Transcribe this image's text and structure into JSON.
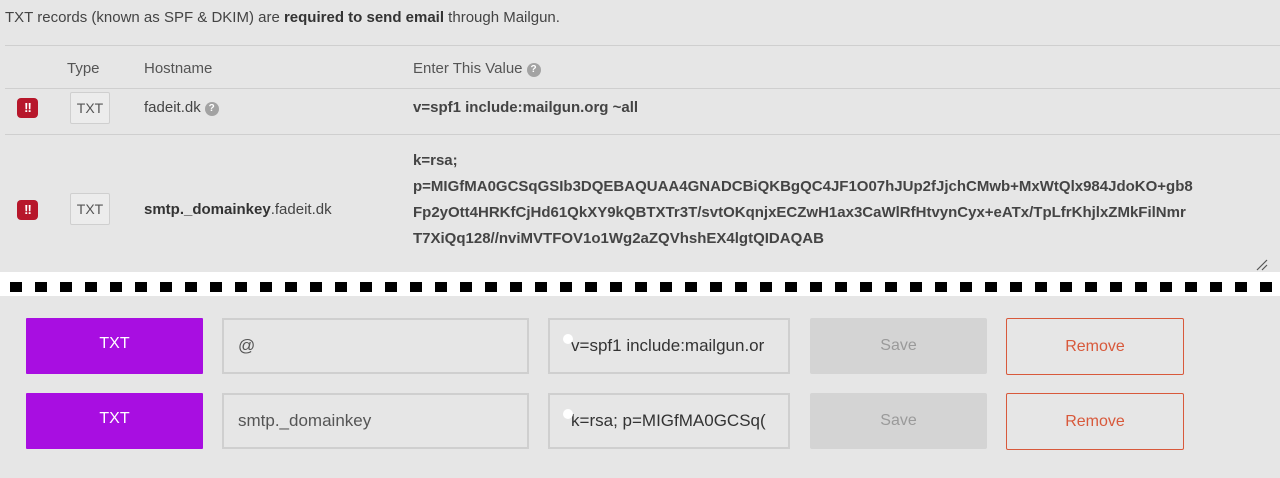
{
  "intro": {
    "text_before": "TXT records (known as SPF & DKIM) are ",
    "text_bold": "required to send email",
    "text_after": " through Mailgun."
  },
  "table": {
    "headers": {
      "type": "Type",
      "hostname": "Hostname",
      "value": "Enter This Value"
    },
    "help_glyph": "?",
    "alert_glyph": "!!",
    "rows": [
      {
        "type": "TXT",
        "hostname_bold": "",
        "hostname_rest": "fadeit.dk",
        "value_lines": [
          "v=spf1 include:mailgun.org ~all"
        ]
      },
      {
        "type": "TXT",
        "hostname_bold": "smtp._domainkey",
        "hostname_rest": ".fadeit.dk",
        "value_lines": [
          "k=rsa;",
          "p=MIGfMA0GCSqGSIb3DQEBAQUAA4GNADCBiQKBgQC4JF1O07hJUp2fJjchCMwb+MxWtQlx984JdoKO+gb8",
          "Fp2yOtt4HRKfCjHd61QkXY9kQBTXTr3T/svtOKqnjxECZwH1ax3CaWlRfHtvynCyx+eATx/TpLfrKhjlxZMkFilNmr",
          "T7XiQq128//nviMVTFOV1o1Wg2aZQVhshEX4lgtQIDAQAB"
        ]
      }
    ]
  },
  "editor": {
    "rows": [
      {
        "type_label": "TXT",
        "host_value": "@",
        "value_value": "\"v=spf1 include:mailgun.or",
        "save_label": "Save",
        "remove_label": "Remove"
      },
      {
        "type_label": "TXT",
        "host_value": "smtp._domainkey",
        "value_value": "\"k=rsa; p=MIGfMA0GCSq(",
        "save_label": "Save",
        "remove_label": "Remove"
      }
    ]
  },
  "colors": {
    "accent_purple": "#a80ee1",
    "alert_red": "#b7172b",
    "remove_orange": "#d8593b"
  }
}
